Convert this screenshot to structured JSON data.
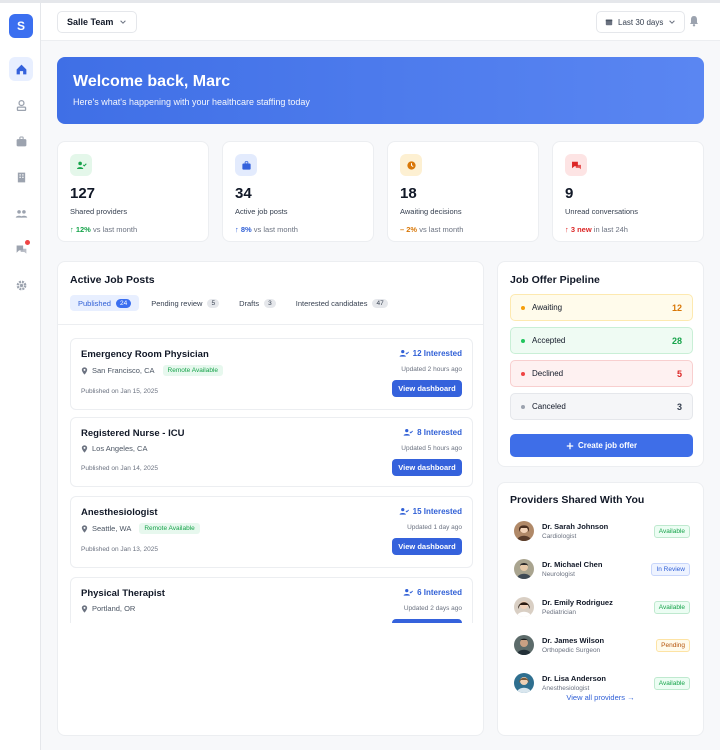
{
  "app": {
    "logo_letter": "S"
  },
  "header": {
    "team": "Salle Team",
    "date_range": "Last 30 days"
  },
  "banner": {
    "title": "Welcome back, Marc",
    "subtitle": "Here's what's happening with your healthcare staffing today"
  },
  "stats": [
    {
      "value": "127",
      "label": "Shared providers",
      "delta": "12%",
      "delta_suffix": "vs last month",
      "delta_prefix": "↑",
      "color": "#16a34a"
    },
    {
      "value": "34",
      "label": "Active job posts",
      "delta": "8%",
      "delta_suffix": "vs last month",
      "delta_prefix": "↑",
      "color": "#2f5fd6"
    },
    {
      "value": "18",
      "label": "Awaiting decisions",
      "delta": "2%",
      "delta_suffix": "vs last month",
      "delta_prefix": "–",
      "color": "#d97706"
    },
    {
      "value": "9",
      "label": "Unread conversations",
      "delta": "3 new",
      "delta_suffix": "in last 24h",
      "delta_prefix": "↑",
      "color": "#dc2626"
    }
  ],
  "jobs": {
    "title": "Active Job Posts",
    "tabs": [
      {
        "label": "Published",
        "count": "24"
      },
      {
        "label": "Pending review",
        "count": "5"
      },
      {
        "label": "Drafts",
        "count": "3"
      },
      {
        "label": "Interested candidates",
        "count": "47"
      }
    ],
    "button_label": "View dashboard",
    "remote_label": "Remote Available",
    "items": [
      {
        "title": "Emergency Room Physician",
        "location": "San Francisco, CA",
        "posted": "Published on Jan 15, 2025",
        "interested": "12 Interested",
        "updated": "Updated 2 hours ago"
      },
      {
        "title": "Registered Nurse - ICU",
        "location": "Los Angeles, CA",
        "posted": "Published on Jan 14, 2025",
        "interested": "8 Interested",
        "updated": "Updated 5 hours ago"
      },
      {
        "title": "Anesthesiologist",
        "location": "Seattle, WA",
        "posted": "Published on Jan 13, 2025",
        "interested": "15 Interested",
        "updated": "Updated 1 day ago"
      },
      {
        "title": "Physical Therapist",
        "location": "Portland, OR",
        "posted": "",
        "interested": "6 Interested",
        "updated": "Updated 2 days ago"
      }
    ]
  },
  "pipeline": {
    "title": "Job Offer Pipeline",
    "rows": [
      {
        "label": "Awaiting",
        "count": "12"
      },
      {
        "label": "Accepted",
        "count": "28"
      },
      {
        "label": "Declined",
        "count": "5"
      },
      {
        "label": "Canceled",
        "count": "3"
      }
    ],
    "create_label": "Create job offer"
  },
  "providers": {
    "title": "Providers Shared With You",
    "items": [
      {
        "name": "Dr. Sarah Johnson",
        "role": "Cardiologist",
        "status": "Available"
      },
      {
        "name": "Dr. Michael Chen",
        "role": "Neurologist",
        "status": "In Review"
      },
      {
        "name": "Dr. Emily Rodriguez",
        "role": "Pediatrician",
        "status": "Available"
      },
      {
        "name": "Dr. James Wilson",
        "role": "Orthopedic Surgeon",
        "status": "Pending"
      },
      {
        "name": "Dr. Lisa Anderson",
        "role": "Anesthesiologist",
        "status": "Available"
      }
    ],
    "view_all": "View all providers →"
  }
}
